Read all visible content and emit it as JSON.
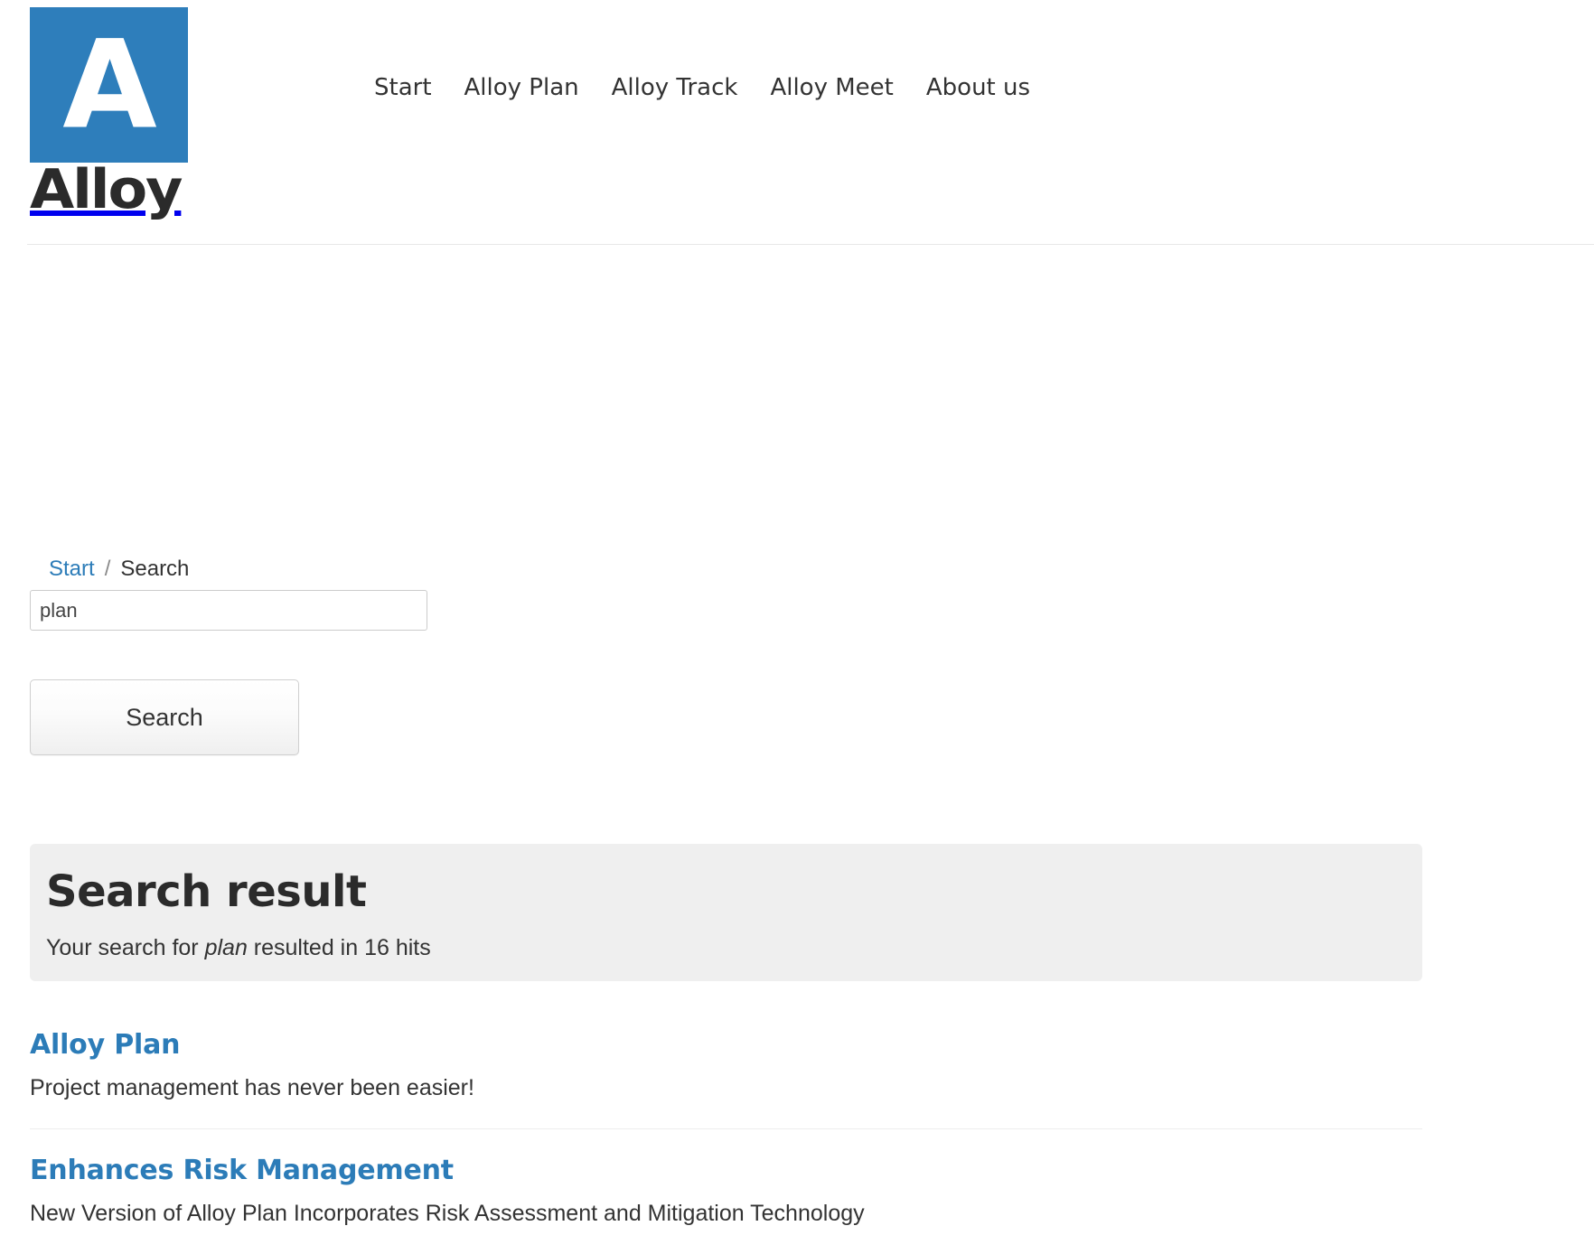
{
  "header": {
    "logo": {
      "mark_letter": "A",
      "wordmark": "Alloy",
      "brand_color": "#2E7EBB"
    },
    "nav": {
      "items": [
        {
          "label": "Start"
        },
        {
          "label": "Alloy Plan"
        },
        {
          "label": "Alloy Track"
        },
        {
          "label": "Alloy Meet"
        },
        {
          "label": "About us"
        }
      ]
    }
  },
  "breadcrumb": {
    "home_label": "Start",
    "separator": "/",
    "current_label": "Search",
    "link_color": "#2C7CB8"
  },
  "search": {
    "input_value": "plan",
    "input_placeholder": "",
    "button_label": "Search"
  },
  "results_panel": {
    "heading": "Search result",
    "summary_prefix": "Your search for",
    "summary_term": "plan",
    "summary_suffix": "resulted in 16 hits",
    "hit_count": 16,
    "background_color": "#EFEFEF"
  },
  "results": [
    {
      "title": "Alloy Plan",
      "description": "Project management has never been easier!"
    },
    {
      "title": "Enhances Risk Management",
      "description": "New Version of Alloy Plan Incorporates Risk Assessment and Mitigation Technology"
    }
  ]
}
